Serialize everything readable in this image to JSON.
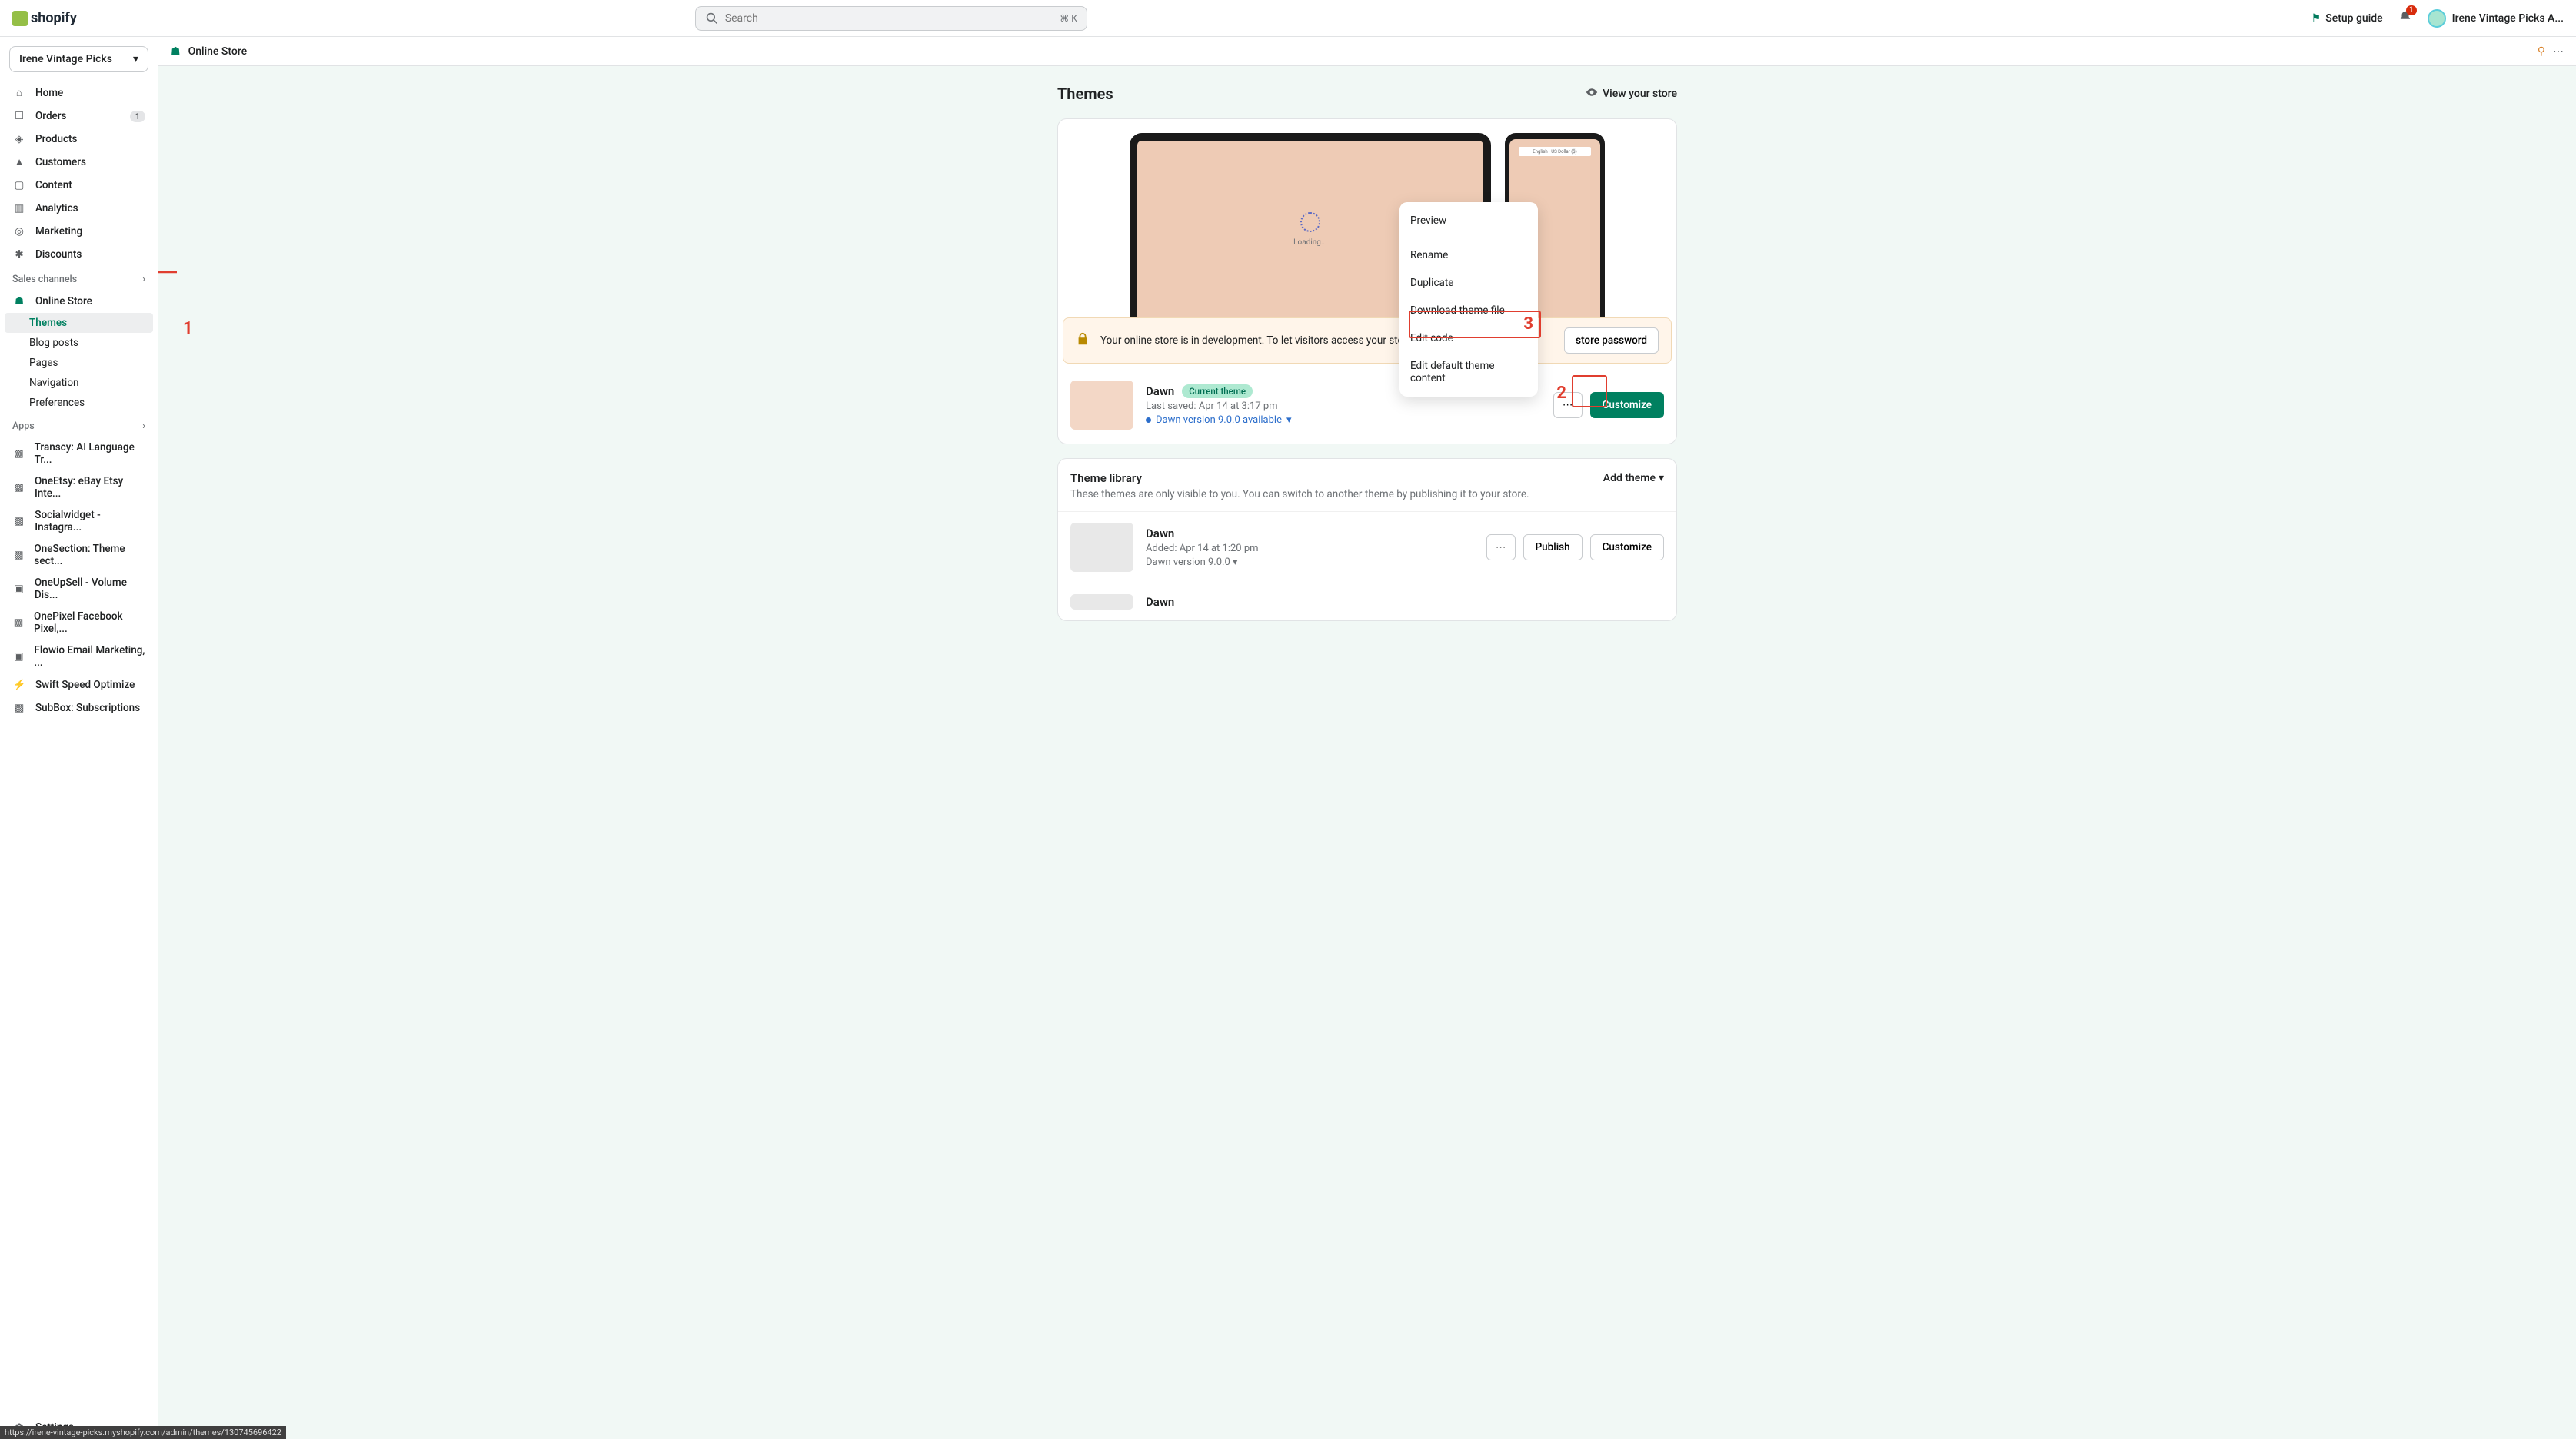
{
  "topbar": {
    "logo_text": "shopify",
    "search_placeholder": "Search",
    "search_kbd": "⌘ K",
    "setup_guide": "Setup guide",
    "bell_badge": "1",
    "user_name": "Irene Vintage Picks A..."
  },
  "store_selector": "Irene Vintage Picks",
  "nav": {
    "home": "Home",
    "orders": "Orders",
    "orders_badge": "1",
    "products": "Products",
    "customers": "Customers",
    "content": "Content",
    "analytics": "Analytics",
    "marketing": "Marketing",
    "discounts": "Discounts",
    "section_sales": "Sales channels",
    "online_store": "Online Store",
    "sub": {
      "themes": "Themes",
      "blog": "Blog posts",
      "pages": "Pages",
      "navigation": "Navigation",
      "preferences": "Preferences"
    },
    "section_apps": "Apps",
    "apps": [
      "Transcy: AI Language Tr...",
      "OneEtsy: eBay Etsy Inte...",
      "Socialwidget - Instagra...",
      "OneSection: Theme sect...",
      "OneUpSell - Volume Dis...",
      "OnePixel Facebook Pixel,...",
      "Flowio Email Marketing, ...",
      "Swift Speed Optimize",
      "SubBox: Subscriptions"
    ],
    "settings": "Settings"
  },
  "header_bar": {
    "title": "Online Store"
  },
  "page": {
    "title": "Themes",
    "view_store": "View your store",
    "loading": "Loading...",
    "phone_bar": "English · US Dollar ($)",
    "banner_text": "Your online store is in development. To let visitors access your store, give them the password.",
    "store_password_btn": "store password",
    "current": {
      "name": "Dawn",
      "chip": "Current theme",
      "saved": "Last saved: Apr 14 at 3:17 pm",
      "version": "Dawn version 9.0.0 available",
      "customize": "Customize"
    },
    "dropdown": {
      "preview": "Preview",
      "rename": "Rename",
      "duplicate": "Duplicate",
      "download": "Download theme file",
      "edit_code": "Edit code",
      "edit_default": "Edit default theme content"
    },
    "library": {
      "title": "Theme library",
      "subtitle": "These themes are only visible to you. You can switch to another theme by publishing it to your store.",
      "add_theme": "Add theme",
      "row1": {
        "name": "Dawn",
        "added": "Added: Apr 14 at 1:20 pm",
        "version": "Dawn version 9.0.0",
        "publish": "Publish",
        "customize": "Customize"
      },
      "row2": {
        "name": "Dawn"
      }
    }
  },
  "annotations": {
    "n1": "1",
    "n2": "2",
    "n3": "3"
  },
  "status_url": "https://irene-vintage-picks.myshopify.com/admin/themes/130745696422"
}
